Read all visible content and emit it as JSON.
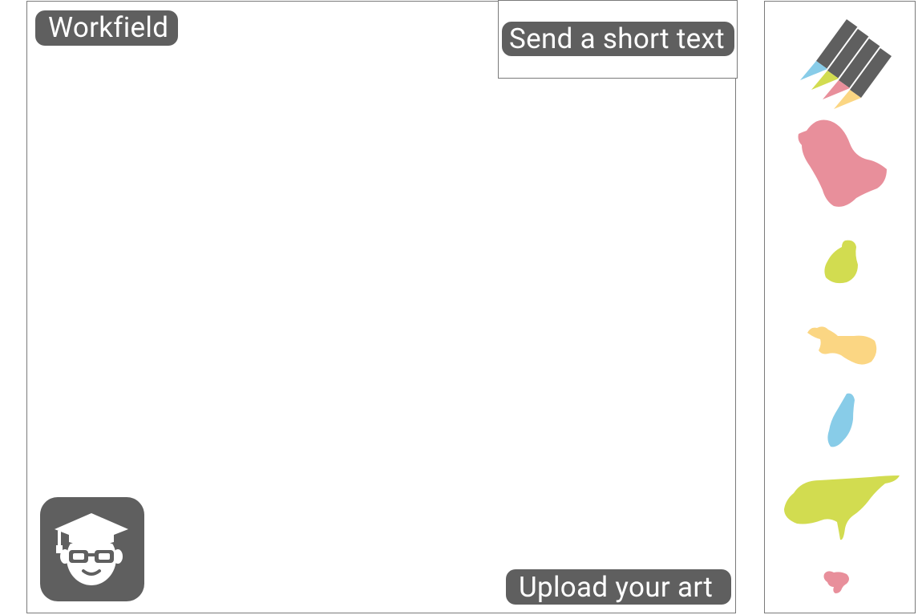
{
  "workfield": {
    "label": "Workfield"
  },
  "send_text": {
    "label": "Send a short text"
  },
  "upload": {
    "label": "Upload your art"
  },
  "avatar": {
    "icon": "student-avatar-icon"
  },
  "tray": {
    "items": [
      {
        "icon": "colored-pencils-icon",
        "colors": [
          "#88cce8",
          "#d2dc50",
          "#e88f9b",
          "#fbd683"
        ]
      },
      {
        "icon": "paint-blob-pink-large-icon",
        "color": "#e88f9b"
      },
      {
        "icon": "paint-blob-green-small-icon",
        "color": "#d2dc50"
      },
      {
        "icon": "paint-blob-yellow-icon",
        "color": "#fbd683"
      },
      {
        "icon": "paint-blob-blue-icon",
        "color": "#88cce8"
      },
      {
        "icon": "paint-blob-green-large-icon",
        "color": "#d2dc50"
      },
      {
        "icon": "paint-blob-pink-small-icon",
        "color": "#e88f9b"
      }
    ]
  },
  "colors": {
    "pill_bg": "#5f5f5f",
    "border": "#7a7a7a",
    "pill_text": "#ffffff"
  }
}
